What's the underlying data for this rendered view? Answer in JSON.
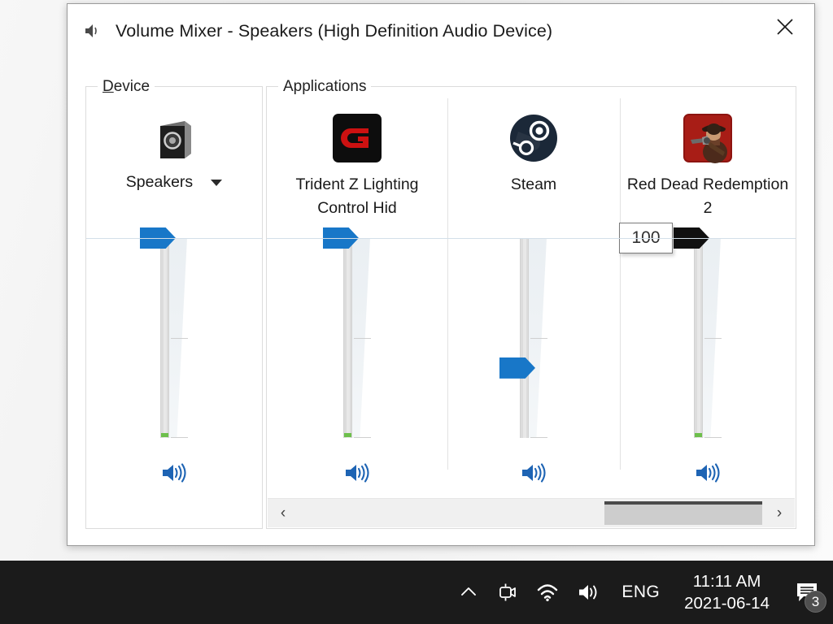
{
  "window": {
    "title": "Volume Mixer - Speakers (High Definition Audio Device)",
    "title_icon": "speaker-icon",
    "close_label": "✕"
  },
  "device_group": {
    "legend_accel": "D",
    "legend_rest": "evice",
    "icon": "speakers-device-icon",
    "name": "Speakers",
    "caret": "chevron-down-icon",
    "slider": {
      "value": 100,
      "thumb_state": "normal",
      "tooltip": null,
      "mute_icon": "volume-on-icon"
    }
  },
  "applications_group": {
    "legend": "Applications",
    "apps": [
      {
        "name": "Trident Z Lighting Control Hid",
        "icon": "gskill-g-logo-icon",
        "slider": {
          "value": 100,
          "thumb_state": "normal",
          "tooltip": null,
          "mute_icon": "volume-on-icon"
        }
      },
      {
        "name": "Steam",
        "icon": "steam-logo-icon",
        "slider": {
          "value": 35,
          "thumb_state": "normal",
          "tooltip": null,
          "mute_icon": "volume-on-icon"
        }
      },
      {
        "name": "Red Dead Redemption 2",
        "icon": "red-dead-redemption-2-icon",
        "slider": {
          "value": 100,
          "thumb_state": "active",
          "tooltip": "100",
          "mute_icon": "volume-on-icon"
        }
      }
    ],
    "scrollbar": {
      "left_arrow": "‹",
      "right_arrow": "›"
    }
  },
  "taskbar": {
    "show_hidden_icons": "chevron-up-icon",
    "recording_icon": "camera-recording-icon",
    "network_icon": "wifi-icon",
    "volume_icon": "volume-on-icon",
    "language": "ENG",
    "time": "11:11 AM",
    "date": "2021-06-14",
    "notifications_icon": "speech-bubble-icon",
    "notifications_count": "3"
  },
  "colors": {
    "accent_blue": "#1877c8",
    "thumb_active": "#101010",
    "peak_green": "#6dbf4b",
    "taskbar": "#1b1b1b"
  }
}
